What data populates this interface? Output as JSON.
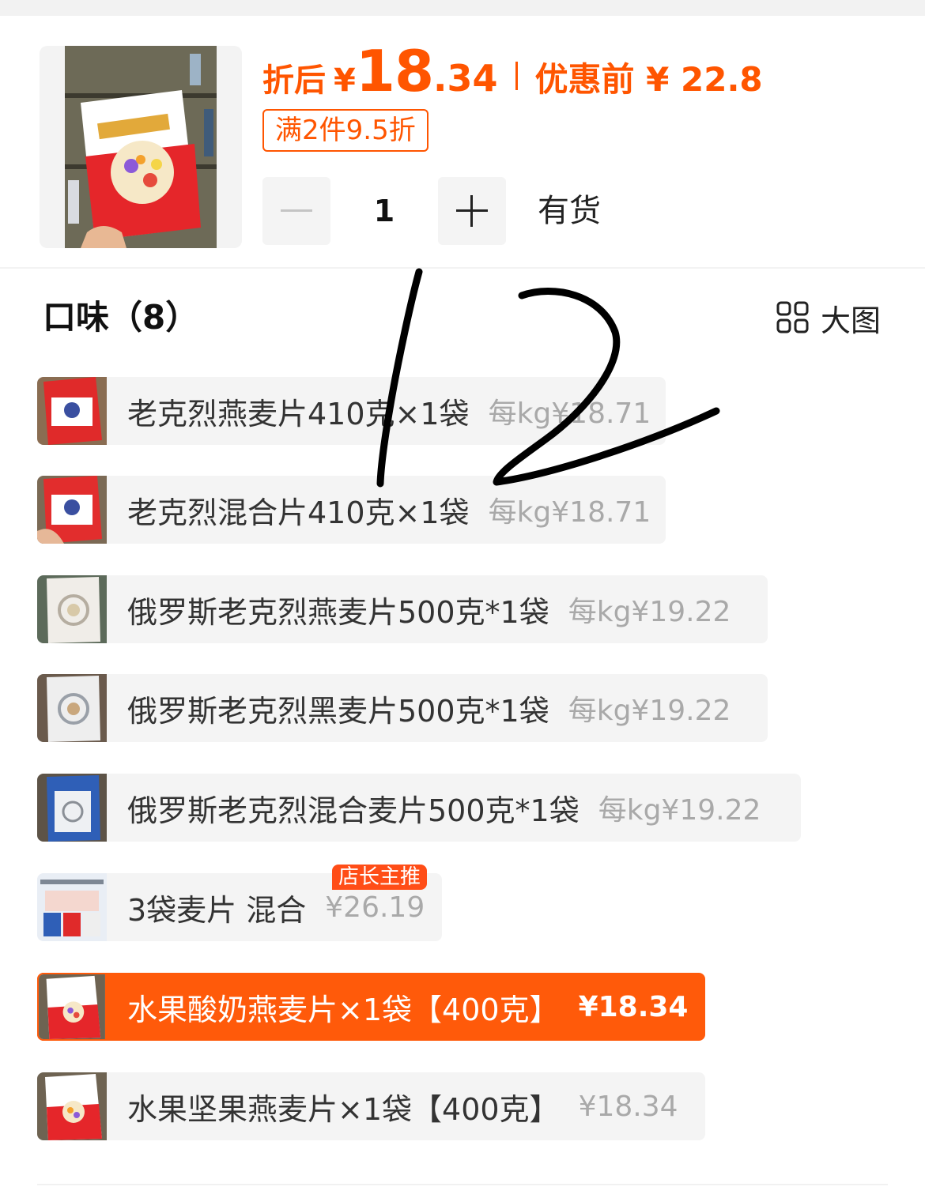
{
  "product": {
    "price_prefix": "折后",
    "currency": "¥",
    "price_int": "18",
    "price_dec": ".34",
    "price_before_label": "优惠前 ¥ 22.8",
    "promo_tag": "满2件9.5折",
    "quantity": "1",
    "stock_status": "有货"
  },
  "section": {
    "title": "口味（8）",
    "big_view_label": "大图"
  },
  "options": [
    {
      "name": "老克烈燕麦片410克×1袋",
      "price": "每kg¥18.71",
      "selected": false
    },
    {
      "name": "老克烈混合片410克×1袋",
      "price": "每kg¥18.71",
      "selected": false
    },
    {
      "name": "俄罗斯老克烈燕麦片500克*1袋",
      "price": "每kg¥19.22",
      "selected": false
    },
    {
      "name": "俄罗斯老克烈黑麦片500克*1袋",
      "price": "每kg¥19.22",
      "selected": false
    },
    {
      "name": "俄罗斯老克烈混合麦片500克*1袋",
      "price": "每kg¥19.22",
      "selected": false
    },
    {
      "name": "3袋麦片 混合",
      "price": "¥26.19",
      "selected": false,
      "badge": "店长主推"
    },
    {
      "name": "水果酸奶燕麦片×1袋【400克】",
      "price": "¥18.34",
      "selected": true
    },
    {
      "name": "水果坚果燕麦片×1袋【400克】",
      "price": "¥18.34",
      "selected": false
    }
  ],
  "handwritten_annotation": "12",
  "colors": {
    "accent": "#ff5500",
    "selected_bg": "#ff5a0a",
    "chip_bg": "#f4f4f4",
    "muted_text": "#a9a9a9"
  }
}
